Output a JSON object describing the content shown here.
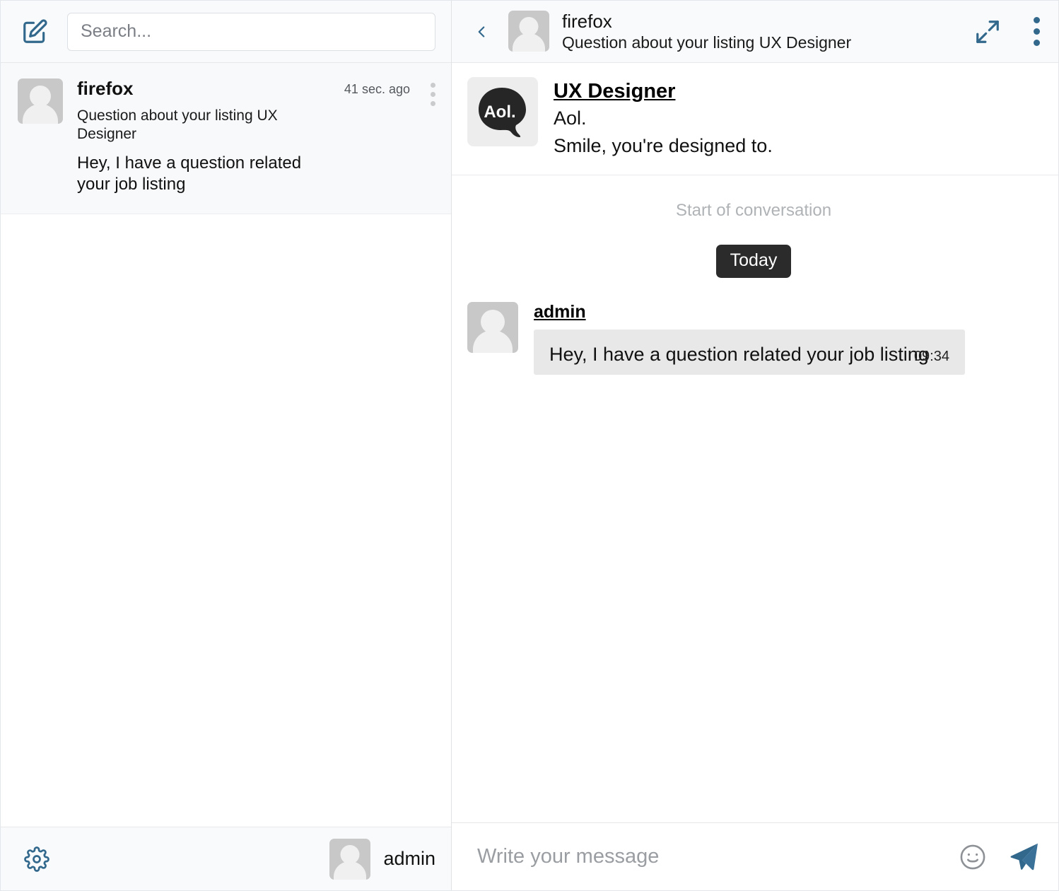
{
  "colors": {
    "accent_blue": "#33688d",
    "header_bg": "#f8fafb",
    "selected_item_bg": "#f7f9fb",
    "bubble_bg": "#e8e8e8",
    "day_chip_bg": "#2b2b2b",
    "avatar_bg": "#c8c8c8",
    "muted_text": "#b0b3b6"
  },
  "left": {
    "compose_icon": "compose-pencil-icon",
    "search": {
      "placeholder": "Search...",
      "value": ""
    },
    "conversations": [
      {
        "avatar": "user-avatar-placeholder",
        "name": "firefox",
        "time": "41 sec. ago",
        "subject": "Question about your listing UX Designer",
        "preview": "Hey, I have a question related your job listing",
        "menu_icon": "more-vertical-icon",
        "selected": true
      }
    ],
    "footer": {
      "settings_icon": "gear-icon",
      "user_name": "admin",
      "user_avatar": "user-avatar-placeholder"
    }
  },
  "right": {
    "header": {
      "back_icon": "chevron-left-icon",
      "avatar": "user-avatar-placeholder",
      "title": "firefox",
      "subtitle": "Question about your listing UX Designer",
      "expand_icon": "expand-arrows-icon",
      "menu_icon": "more-vertical-icon"
    },
    "profile": {
      "logo_text": "Aol.",
      "logo_icon": "aol-speech-bubble-logo",
      "name": "UX Designer",
      "line1": "Aol.",
      "line2": "Smile, you're designed to."
    },
    "conversation": {
      "start_note": "Start of conversation",
      "day_label": "Today",
      "messages": [
        {
          "avatar": "user-avatar-placeholder",
          "author": "admin",
          "text": "Hey, I have a question related your job listing",
          "time": "09:34"
        }
      ]
    },
    "composer": {
      "placeholder": "Write your message",
      "value": "",
      "emoji_icon": "smiley-icon",
      "send_icon": "send-paper-plane-icon"
    }
  }
}
